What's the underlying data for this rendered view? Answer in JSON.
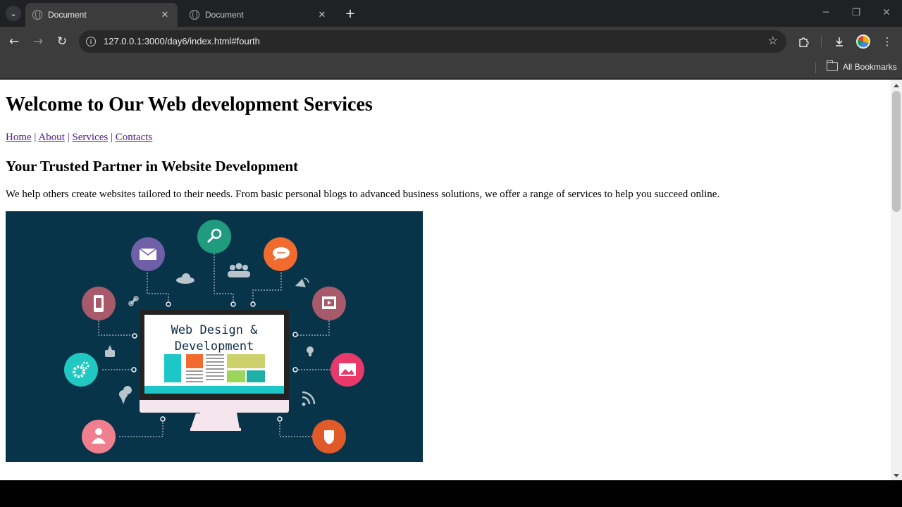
{
  "browser": {
    "tabs": [
      {
        "title": "Document",
        "active": true
      },
      {
        "title": "Document",
        "active": false
      }
    ],
    "url": "127.0.0.1:3000/day6/index.html#fourth",
    "bookmarks_label": "All Bookmarks"
  },
  "page": {
    "heading": "Welcome to Our Web development Services",
    "nav": [
      "Home",
      "About",
      "Services",
      "Contacts"
    ],
    "nav_separator": "|",
    "subheading": "Your Trusted Partner in Website Development",
    "description": "We help others create websites tailored to their needs. From basic personal blogs to advanced business solutions, we offer a range of services to help you succeed online.",
    "hero_image": {
      "caption_line1": "Web Design &",
      "caption_line2": "Development",
      "background": "#08344a",
      "icons": [
        "mail-icon",
        "search-icon",
        "chat-icon",
        "phone-icon",
        "video-icon",
        "gears-icon",
        "image-icon",
        "user-icon",
        "shield-icon",
        "cloud-icon",
        "users-icon",
        "satellite-icon",
        "link-icon",
        "thumbs-up-icon",
        "bulb-icon",
        "location-pin-icon",
        "rss-icon"
      ]
    }
  }
}
